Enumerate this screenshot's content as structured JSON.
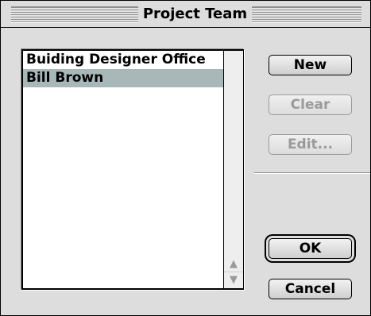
{
  "window": {
    "title": "Project Team"
  },
  "list": {
    "items": [
      {
        "label": "Buiding Designer Office",
        "selected": false
      },
      {
        "label": "Bill Brown",
        "selected": true
      }
    ]
  },
  "buttons": {
    "new": "New",
    "clear": "Clear",
    "edit": "Edit...",
    "ok": "OK",
    "cancel": "Cancel"
  },
  "icons": {
    "scroll_up": "triangle-up-icon",
    "scroll_down": "triangle-down-icon"
  },
  "colors": {
    "selection": "#a8b8b8",
    "dialog_background": "#dddddd",
    "disabled_text": "#9a9a9a"
  }
}
